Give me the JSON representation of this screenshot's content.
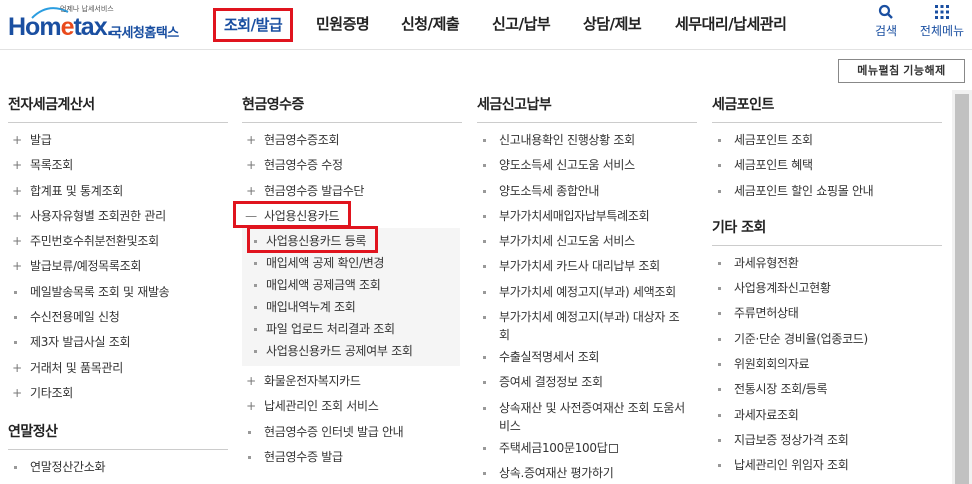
{
  "header": {
    "logo_tagline": "언제나 납세서비스",
    "logo_text_a": "Hom",
    "logo_text_e": "e",
    "logo_text_b": "tax.",
    "logo_korean": "국세청홈택스",
    "nav": [
      {
        "label": "조회/발급",
        "active": true
      },
      {
        "label": "민원증명"
      },
      {
        "label": "신청/제출"
      },
      {
        "label": "신고/납부"
      },
      {
        "label": "상담/제보"
      },
      {
        "label": "세무대리/납세관리"
      }
    ],
    "search_label": "검색",
    "allmenu_label": "전체메뉴",
    "menu_toggle_label": "메뉴펼침 기능해제"
  },
  "columns": {
    "c1": {
      "title": "전자세금계산서",
      "items": [
        "발급",
        "목록조회",
        "합계표 및 통계조회",
        "사용자유형별 조회권한 관리",
        "주민번호수취분전환및조회",
        "발급보류/예정목록조회",
        "메일발송목록 조회 및 재발송",
        "수신전용메일 신청",
        "제3자 발급사실 조회",
        "거래처 및 품목관리",
        "기타조회"
      ],
      "title2": "연말정산",
      "items2": [
        "연말정산간소화"
      ]
    },
    "c2": {
      "title": "현금영수증",
      "items": [
        "현금영수증조회",
        "현금영수증 수정",
        "현금영수증 발급수단"
      ],
      "expanded": "사업용신용카드",
      "sub": [
        "사업용신용카드 등록",
        "매입세액 공제 확인/변경",
        "매입세액 공제금액 조회",
        "매입내역누계 조회",
        "파일 업로드 처리결과 조회",
        "사업용신용카드 공제여부 조회"
      ],
      "items_after": [
        "화물운전자복지카드",
        "납세관리인 조회 서비스"
      ],
      "items_dot": [
        "현금영수증 인터넷 발급 안내",
        "현금영수증 발급"
      ]
    },
    "c3": {
      "title": "세금신고납부",
      "items": [
        "신고내용확인 진행상황 조회",
        "양도소득세 신고도움 서비스",
        "양도소득세 종합안내",
        "부가가치세매입자납부특례조회",
        "부가가치세 신고도움 서비스",
        "부가가치세 카드사 대리납부 조회",
        "부가가치세 예정고지(부과) 세액조회",
        "부가가치세 예정고지(부과) 대상자 조회",
        "수출실적명세서 조회",
        "증여세 결정정보 조회",
        "상속재산 및 사전증여재산 조회 도움서비스",
        "주택세금100문100답",
        "상속.증여재산 평가하기"
      ]
    },
    "c4": {
      "title": "세금포인트",
      "items": [
        "세금포인트 조회",
        "세금포인트 혜택",
        "세금포인트 할인 쇼핑몰 안내"
      ],
      "title2": "기타 조회",
      "items2": [
        "과세유형전환",
        "사업용계좌신고현황",
        "주류면허상태",
        "기준·단순 경비율(업종코드)",
        "위원회회의자료",
        "전통시장 조회/등록",
        "과세자료조회",
        "지급보증 정상가격 조회",
        "납세관리인 위임자 조회"
      ]
    }
  }
}
